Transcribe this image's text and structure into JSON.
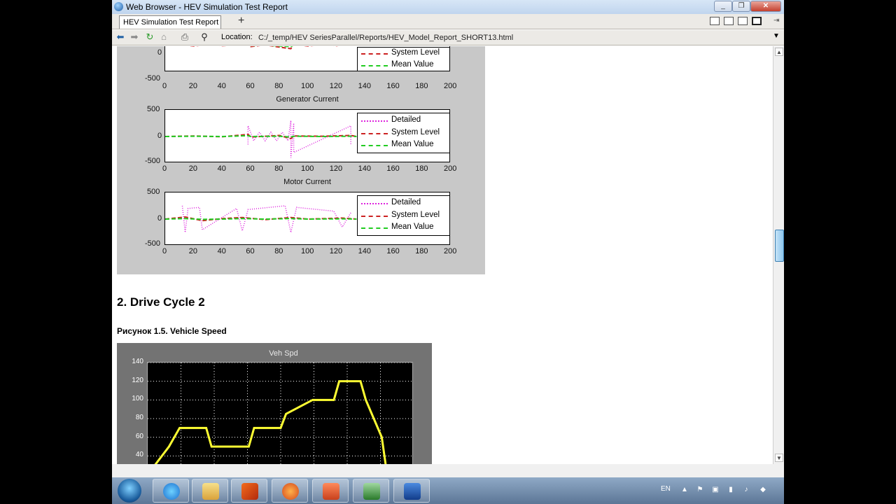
{
  "window": {
    "title": "Web Browser - HEV Simulation Test Report",
    "controls": [
      "minimize",
      "restore",
      "close"
    ]
  },
  "tabs": [
    {
      "label": "HEV Simulation Test Report",
      "active": true
    }
  ],
  "toolbar": {
    "location_label": "Location:",
    "url": "C:/_temp/HEV SeriesParallel/Reports/HEV_Model_Report_SHORT13.html"
  },
  "report": {
    "section_heading": "2. Drive Cycle 2",
    "figure_caption": "Рисунок 1.5. Vehicle Speed"
  },
  "chart_data": [
    {
      "type": "line",
      "title": "",
      "x_ticks": [
        "0",
        "20",
        "40",
        "60",
        "80",
        "100",
        "120",
        "140",
        "160",
        "180",
        "200"
      ],
      "y_ticks": [
        "0",
        "-500"
      ],
      "xlim": [
        0,
        200
      ],
      "ylim": [
        -500,
        500
      ],
      "legend": [
        "System Level",
        "Mean Value"
      ],
      "legend_placement": "top-right",
      "series": [
        {
          "name": "System Level",
          "x": [
            0,
            10,
            20,
            30,
            40,
            50,
            58,
            60,
            70,
            80,
            88,
            90,
            100,
            110,
            120,
            130,
            134
          ],
          "y": [
            0,
            20,
            -10,
            15,
            -5,
            10,
            60,
            -20,
            10,
            -30,
            -60,
            20,
            -10,
            15,
            -5,
            30,
            0
          ],
          "color": "#cc2222"
        },
        {
          "name": "Mean Value",
          "x": [
            0,
            10,
            20,
            30,
            40,
            50,
            58,
            60,
            70,
            80,
            88,
            90,
            100,
            110,
            120,
            130,
            134
          ],
          "y": [
            0,
            5,
            0,
            5,
            0,
            5,
            20,
            -5,
            5,
            -10,
            -20,
            5,
            0,
            5,
            0,
            10,
            0
          ],
          "color": "#22cc22"
        }
      ]
    },
    {
      "type": "line",
      "title": "Generator Current",
      "x_ticks": [
        "0",
        "20",
        "40",
        "60",
        "80",
        "100",
        "120",
        "140",
        "160",
        "180",
        "200"
      ],
      "y_ticks": [
        "500",
        "0",
        "-500"
      ],
      "xlim": [
        0,
        200
      ],
      "ylim": [
        -500,
        500
      ],
      "legend": [
        "Detailed",
        "System Level",
        "Mean Value"
      ],
      "legend_placement": "top-right",
      "series": [
        {
          "name": "Detailed",
          "x": [
            58,
            58,
            62,
            66,
            70,
            74,
            78,
            82,
            86,
            88,
            88,
            90,
            90,
            130,
            130
          ],
          "y": [
            -150,
            200,
            -80,
            80,
            -80,
            80,
            -80,
            80,
            -80,
            300,
            -400,
            250,
            -300,
            200,
            -150
          ],
          "color": "#dd22dd"
        },
        {
          "name": "System Level",
          "x": [
            0,
            20,
            40,
            58,
            60,
            80,
            88,
            90,
            110,
            130,
            134
          ],
          "y": [
            0,
            10,
            -5,
            40,
            -10,
            20,
            -40,
            10,
            5,
            20,
            0
          ],
          "color": "#cc2222"
        },
        {
          "name": "Mean Value",
          "x": [
            0,
            20,
            40,
            58,
            60,
            80,
            88,
            90,
            110,
            130,
            134
          ],
          "y": [
            0,
            5,
            0,
            15,
            0,
            5,
            -10,
            5,
            0,
            5,
            0
          ],
          "color": "#22cc22"
        }
      ]
    },
    {
      "type": "line",
      "title": "Motor Current",
      "x_ticks": [
        "0",
        "20",
        "40",
        "60",
        "80",
        "100",
        "120",
        "140",
        "160",
        "180",
        "200"
      ],
      "y_ticks": [
        "500",
        "0",
        "-500"
      ],
      "xlim": [
        0,
        200
      ],
      "ylim": [
        -500,
        500
      ],
      "legend": [
        "Detailed",
        "System Level",
        "Mean Value"
      ],
      "legend_placement": "top-right",
      "series": [
        {
          "name": "Detailed",
          "x": [
            12,
            14,
            16,
            24,
            26,
            50,
            54,
            58,
            84,
            88,
            92,
            118,
            124,
            130
          ],
          "y": [
            250,
            -250,
            200,
            220,
            -200,
            200,
            -220,
            180,
            250,
            -250,
            220,
            150,
            -150,
            120
          ],
          "color": "#dd22dd"
        },
        {
          "name": "System Level",
          "x": [
            0,
            14,
            26,
            40,
            54,
            70,
            88,
            100,
            124,
            134
          ],
          "y": [
            0,
            40,
            -30,
            10,
            30,
            -10,
            30,
            0,
            20,
            0
          ],
          "color": "#cc2222"
        },
        {
          "name": "Mean Value",
          "x": [
            0,
            14,
            26,
            40,
            54,
            70,
            88,
            100,
            124,
            134
          ],
          "y": [
            0,
            10,
            -5,
            0,
            10,
            0,
            10,
            0,
            5,
            0
          ],
          "color": "#22cc22"
        }
      ]
    },
    {
      "type": "line",
      "title": "Veh Spd",
      "y_ticks": [
        "140",
        "120",
        "100",
        "80",
        "60",
        "40"
      ],
      "ylim": [
        20,
        140
      ],
      "grid": true,
      "series": [
        {
          "name": "",
          "x": [
            0,
            8,
            12,
            22,
            24,
            38,
            40,
            50,
            52,
            62,
            70,
            72,
            80,
            82,
            88,
            90
          ],
          "y": [
            20,
            50,
            70,
            70,
            50,
            50,
            70,
            70,
            85,
            100,
            100,
            120,
            120,
            100,
            60,
            20
          ],
          "color": "#ffff33"
        }
      ]
    }
  ],
  "taskbar": {
    "apps": [
      "internet-explorer",
      "file-explorer",
      "matlab",
      "firefox",
      "powerpoint",
      "network-monitor",
      "remote-desktop"
    ],
    "tray_lang": "EN"
  }
}
